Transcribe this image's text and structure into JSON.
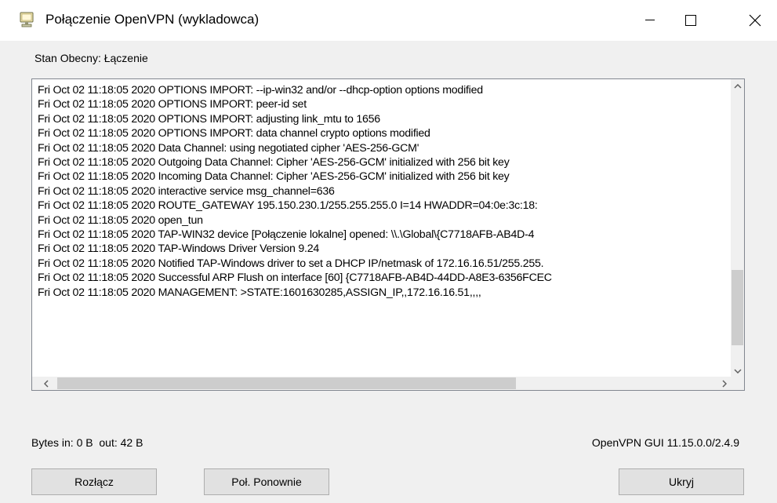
{
  "window": {
    "title": "Połączenie OpenVPN (wykladowca)",
    "icon": "computer-network-icon",
    "controls": [
      "minimize-icon",
      "maximize-icon",
      "close-icon"
    ]
  },
  "status": {
    "text": "Stan Obecny: Łączenie"
  },
  "log": {
    "lines": [
      "Fri Oct 02 11:18:05 2020 OPTIONS IMPORT: --ip-win32 and/or --dhcp-option options modified",
      "Fri Oct 02 11:18:05 2020 OPTIONS IMPORT: peer-id set",
      "Fri Oct 02 11:18:05 2020 OPTIONS IMPORT: adjusting link_mtu to 1656",
      "Fri Oct 02 11:18:05 2020 OPTIONS IMPORT: data channel crypto options modified",
      "Fri Oct 02 11:18:05 2020 Data Channel: using negotiated cipher 'AES-256-GCM'",
      "Fri Oct 02 11:18:05 2020 Outgoing Data Channel: Cipher 'AES-256-GCM' initialized with 256 bit key",
      "Fri Oct 02 11:18:05 2020 Incoming Data Channel: Cipher 'AES-256-GCM' initialized with 256 bit key",
      "Fri Oct 02 11:18:05 2020 interactive service msg_channel=636",
      "Fri Oct 02 11:18:05 2020 ROUTE_GATEWAY 195.150.230.1/255.255.255.0 I=14 HWADDR=04:0e:3c:18:",
      "Fri Oct 02 11:18:05 2020 open_tun",
      "Fri Oct 02 11:18:05 2020 TAP-WIN32 device [Połączenie lokalne] opened: \\\\.\\Global\\{C7718AFB-AB4D-4",
      "Fri Oct 02 11:18:05 2020 TAP-Windows Driver Version 9.24",
      "Fri Oct 02 11:18:05 2020 Notified TAP-Windows driver to set a DHCP IP/netmask of 172.16.16.51/255.255.",
      "Fri Oct 02 11:18:05 2020 Successful ARP Flush on interface [60] {C7718AFB-AB4D-44DD-A8E3-6356FCEC",
      "Fri Oct 02 11:18:05 2020 MANAGEMENT: >STATE:1601630285,ASSIGN_IP,,172.16.16.51,,,,"
    ]
  },
  "footer": {
    "bytes": "Bytes in: 0 B  out: 42 B",
    "version": "OpenVPN GUI 11.15.0.0/2.4.9"
  },
  "buttons": {
    "disconnect": "Rozłącz",
    "reconnect": "Poł. Ponownie",
    "hide": "Ukryj"
  }
}
